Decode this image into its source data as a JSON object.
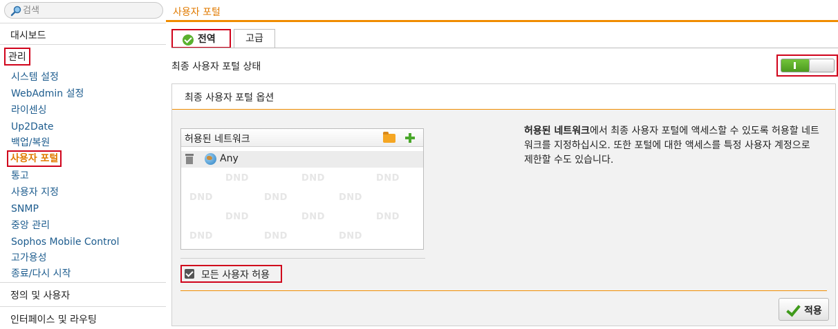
{
  "search": {
    "placeholder": "검색"
  },
  "sidebar": {
    "dashboard": "대시보드",
    "group_title": "관리",
    "items": [
      {
        "label": "시스템 설정"
      },
      {
        "label": "WebAdmin 설정"
      },
      {
        "label": "라이센싱"
      },
      {
        "label": "Up2Date"
      },
      {
        "label": "백업/복원"
      },
      {
        "label": "사용자 포털",
        "active": true
      },
      {
        "label": "통고"
      },
      {
        "label": "사용자 지정"
      },
      {
        "label": "SNMP"
      },
      {
        "label": "중앙 관리"
      },
      {
        "label": "Sophos Mobile Control"
      },
      {
        "label": "고가용성"
      },
      {
        "label": "종료/다시 시작"
      }
    ],
    "sections": [
      "정의 및 사용자",
      "인터페이스 및 라우팅"
    ]
  },
  "header": {
    "title": "사용자 포털"
  },
  "tabs": [
    {
      "label": "전역",
      "active": true
    },
    {
      "label": "고급"
    }
  ],
  "status": {
    "label": "최종 사용자 포털 상태",
    "enabled": true
  },
  "panel": {
    "title": "최종 사용자 포털 옵션",
    "networks_title": "허용된 네트워크",
    "networks": [
      "Any"
    ],
    "dnd_text": "DND",
    "hint_bold": "허용된 네트워크",
    "hint_rest": "에서 최종 사용자 포털에 액세스할 수 있도록 허용할 네트워크를 지정하십시오. 또한 포털에 대한 액세스를 특정 사용자 계정으로 제한할 수도 있습니다.",
    "allow_all_label": "모든 사용자 허용",
    "allow_all_checked": true,
    "apply_label": "적용"
  },
  "colors": {
    "accent": "#f08c00",
    "highlight": "#d0021b",
    "link": "#1d5c8e",
    "toggle_on": "#5ab12f"
  }
}
